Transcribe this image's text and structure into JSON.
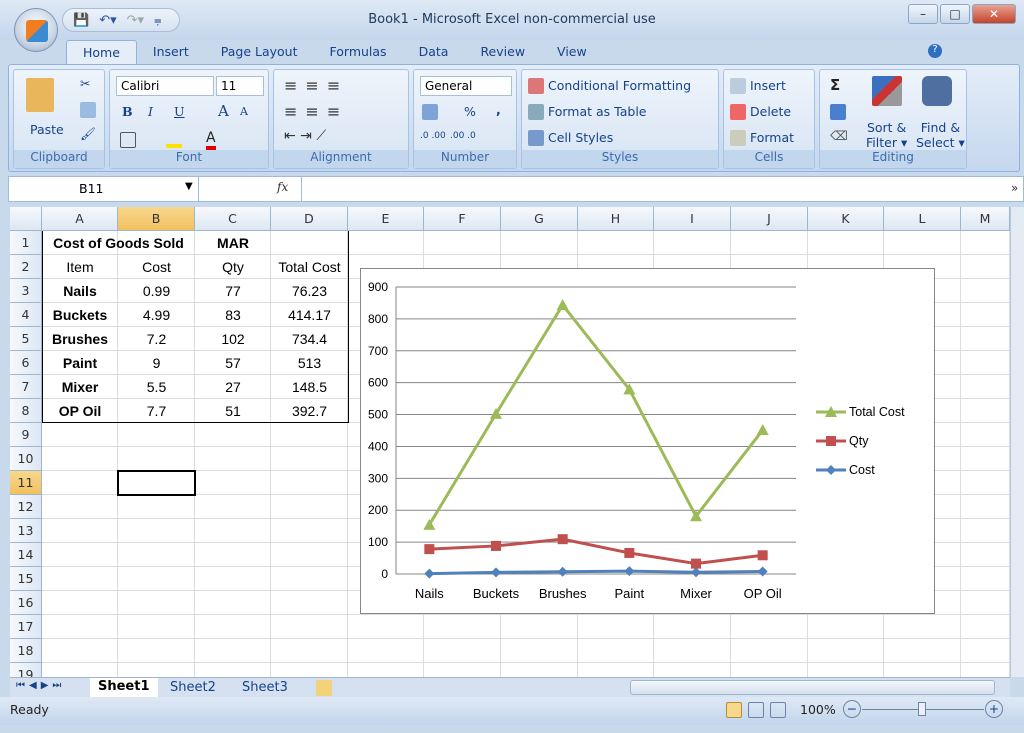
{
  "window": {
    "title": "Book1 - Microsoft Excel non-commercial use",
    "minimize": "–",
    "maximize": "□",
    "close": "✕"
  },
  "tabs": [
    "Home",
    "Insert",
    "Page Layout",
    "Formulas",
    "Data",
    "Review",
    "View"
  ],
  "ribbon": {
    "clipboard": {
      "label": "Clipboard",
      "paste": "Paste"
    },
    "font": {
      "label": "Font",
      "name": "Calibri",
      "size": "11",
      "bold": "B",
      "italic": "I",
      "underline": "U",
      "grow": "A",
      "shrink": "A",
      "color": "A"
    },
    "alignment": {
      "label": "Alignment"
    },
    "number": {
      "label": "Number",
      "format": "General",
      "percent": "%",
      "comma": ",",
      "inc_decimal": ".0 .00",
      "dec_decimal": ".00 .0"
    },
    "styles": {
      "label": "Styles",
      "conditional": "Conditional Formatting",
      "format_table": "Format as Table",
      "cell_styles": "Cell Styles"
    },
    "cells": {
      "label": "Cells",
      "insert": "Insert",
      "delete": "Delete",
      "format": "Format"
    },
    "editing": {
      "label": "Editing",
      "sum": "Σ",
      "sort1": "Sort &",
      "sort2": "Filter",
      "find1": "Find &",
      "find2": "Select"
    }
  },
  "formula_bar": {
    "name_box": "B11",
    "fx": "fx",
    "value": ""
  },
  "columns": [
    "A",
    "B",
    "C",
    "D",
    "E",
    "F",
    "G",
    "H",
    "I",
    "J",
    "K",
    "L",
    "M"
  ],
  "rows": [
    "1",
    "2",
    "3",
    "4",
    "5",
    "6",
    "7",
    "8",
    "9",
    "10",
    "11",
    "12",
    "13",
    "14",
    "15",
    "16",
    "17",
    "18",
    "19"
  ],
  "selected_cell": "B11",
  "sheet": {
    "title": "Cost of Goods Sold",
    "month": "MAR",
    "headers": [
      "Item",
      "Cost",
      "Qty",
      "Total Cost"
    ],
    "data": [
      [
        "Nails",
        "0.99",
        "77",
        "76.23"
      ],
      [
        "Buckets",
        "4.99",
        "83",
        "414.17"
      ],
      [
        "Brushes",
        "7.2",
        "102",
        "734.4"
      ],
      [
        "Paint",
        "9",
        "57",
        "513"
      ],
      [
        "Mixer",
        "5.5",
        "27",
        "148.5"
      ],
      [
        "OP Oil",
        "7.7",
        "51",
        "392.7"
      ]
    ]
  },
  "chart_data": {
    "type": "line",
    "stacked": true,
    "categories": [
      "Nails",
      "Buckets",
      "Brushes",
      "Paint",
      "Mixer",
      "OP Oil"
    ],
    "series": [
      {
        "name": "Cost",
        "values": [
          0.99,
          4.99,
          7.2,
          9,
          5.5,
          7.7
        ],
        "color": "#4f81bd",
        "marker": "diamond"
      },
      {
        "name": "Qty",
        "values": [
          77,
          83,
          102,
          57,
          27,
          51
        ],
        "color": "#c0504d",
        "marker": "square"
      },
      {
        "name": "Total Cost",
        "values": [
          76.23,
          414.17,
          734.4,
          513,
          148.5,
          392.7
        ],
        "color": "#9bbb59",
        "marker": "triangle"
      }
    ],
    "yticks": [
      "0",
      "100",
      "200",
      "300",
      "400",
      "500",
      "600",
      "700",
      "800",
      "900"
    ],
    "ylim": [
      0,
      900
    ],
    "grid": true,
    "legend": "right",
    "legend_order": [
      "Total Cost",
      "Qty",
      "Cost"
    ]
  },
  "sheet_tabs": [
    "Sheet1",
    "Sheet2",
    "Sheet3"
  ],
  "active_sheet": "Sheet1",
  "status": {
    "ready": "Ready",
    "zoom": "100%"
  }
}
